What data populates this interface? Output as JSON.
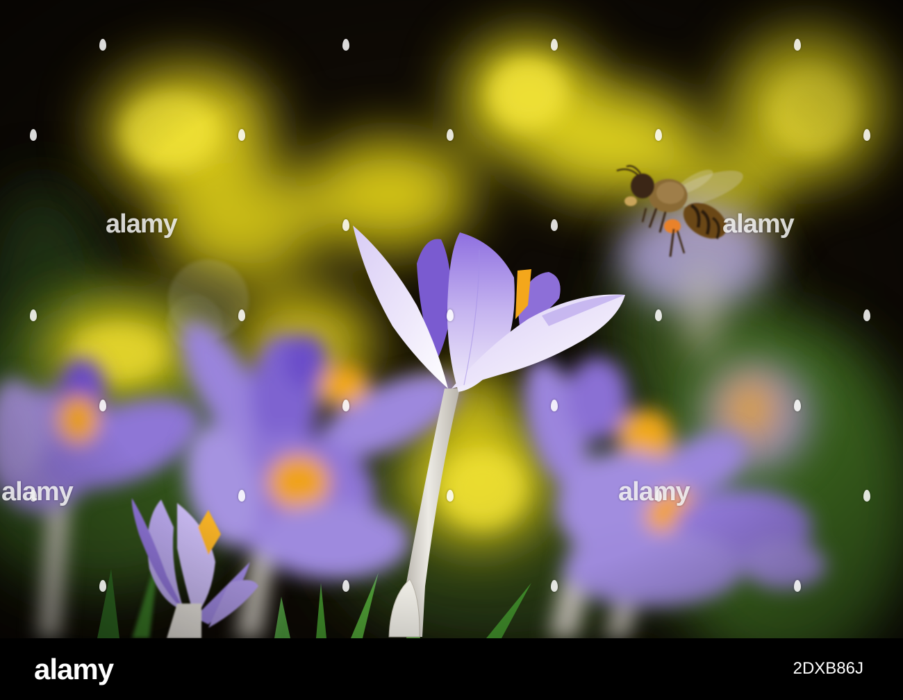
{
  "watermark": {
    "text": "alamy"
  },
  "footer": {
    "logo": "alamy",
    "image_id": "2DXB86J"
  },
  "colors": {
    "background_dark": "#0d0904",
    "bokeh_yellow": "#e6d21e",
    "crocus_purple": "#8f6fd8",
    "crocus_light": "#e9e1f8",
    "stamen_orange": "#f6a21a",
    "stem_white": "#ddd9d4",
    "leaf_green": "#5e9a35",
    "bee_brown": "#5b3a17",
    "footer_black": "#000000"
  }
}
